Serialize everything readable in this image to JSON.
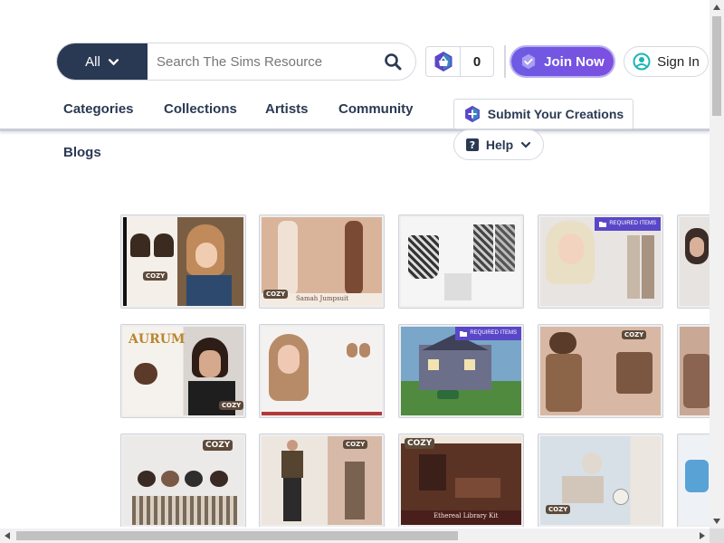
{
  "search": {
    "scope_label": "All",
    "placeholder": "Search The Sims Resource"
  },
  "basket": {
    "count": "0"
  },
  "header": {
    "join_label": "Join Now",
    "signin_label": "Sign In"
  },
  "nav": {
    "items": [
      "Categories",
      "Collections",
      "Artists",
      "Community"
    ],
    "submit_label": "Submit Your Creations",
    "help_label": "Help",
    "blogs_label": "Blogs"
  },
  "grid": {
    "required_badge": "REQUIRED ITEMS",
    "cards": [
      {
        "label": "",
        "cozy": "COZY"
      },
      {
        "label": "Samah Jumpsuit",
        "cozy": "COZY"
      },
      {
        "label": "",
        "cozy": ""
      },
      {
        "label": "",
        "cozy": ""
      },
      {
        "label": "",
        "cozy": ""
      },
      {
        "label": "AURUM",
        "cozy": "COZY"
      },
      {
        "label": "",
        "cozy": ""
      },
      {
        "label": "",
        "cozy": ""
      },
      {
        "label": "",
        "cozy": "COZY"
      },
      {
        "label": "",
        "cozy": ""
      },
      {
        "label": "",
        "cozy": "COZY"
      },
      {
        "label": "",
        "cozy": "COZY"
      },
      {
        "label": "Ethereal Library Kit",
        "cozy": "COZY"
      },
      {
        "label": "",
        "cozy": "COZY"
      },
      {
        "label": "",
        "cozy": ""
      }
    ]
  },
  "colors": {
    "brand_dark": "#2a3953",
    "join_purple": "#6d5be3",
    "accent_teal": "#1bb5b5"
  }
}
